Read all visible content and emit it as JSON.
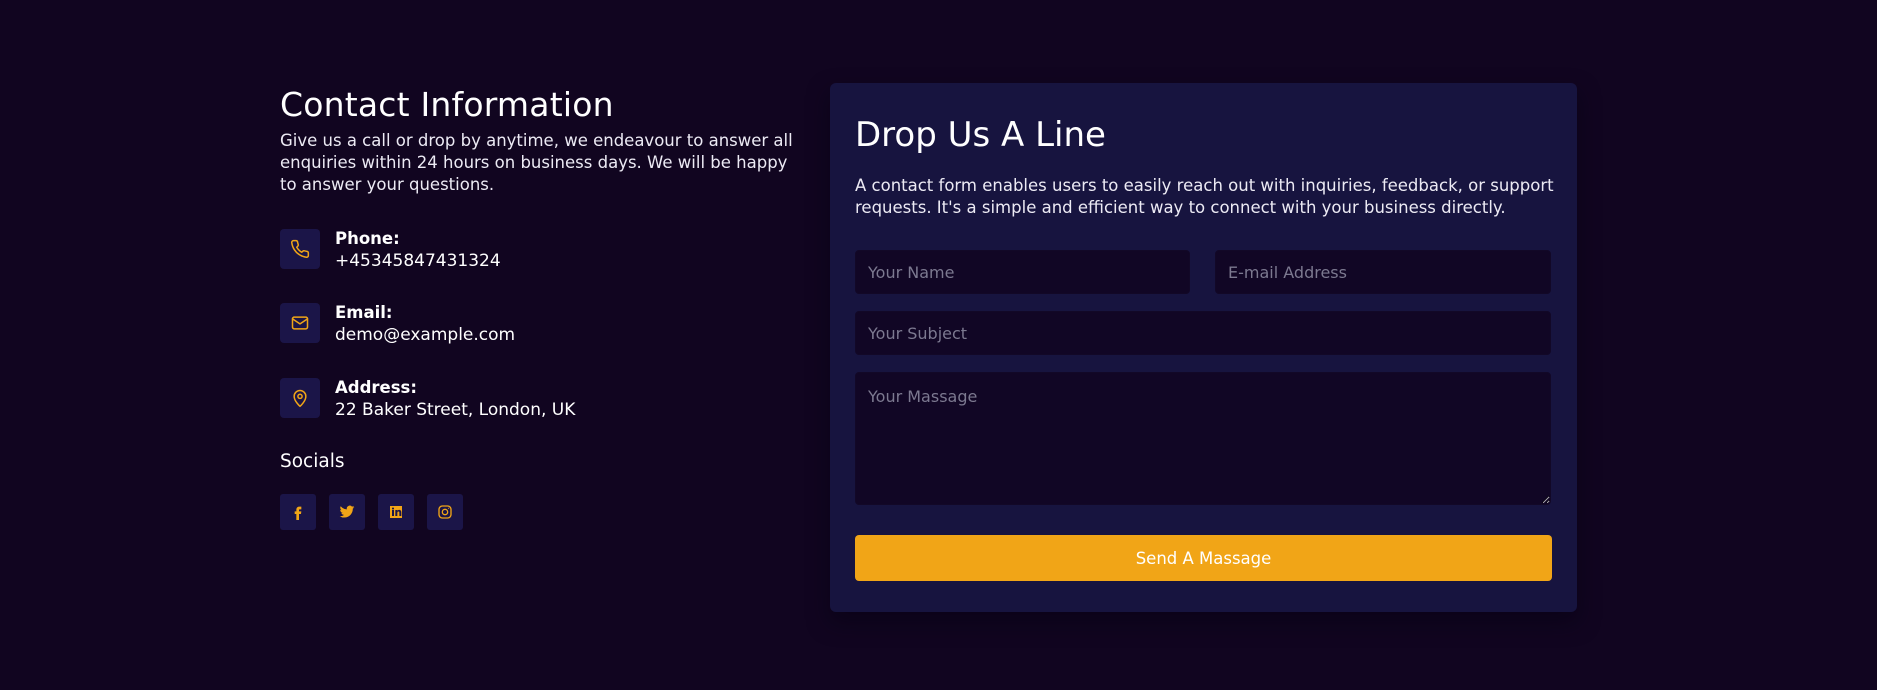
{
  "colors": {
    "background": "#110520",
    "card": "#17143f",
    "icon_tile": "#1b1548",
    "field_bg": "#110625",
    "accent": "#f1a517"
  },
  "contact_info": {
    "title": "Contact Information",
    "intro": "Give us a call or drop by anytime, we endeavour to answer all enquiries within 24 hours on business days. We will be happy to answer your questions.",
    "items": [
      {
        "icon": "phone-icon",
        "label": "Phone:",
        "value": "+45345847431324"
      },
      {
        "icon": "mail-icon",
        "label": "Email:",
        "value": "demo@example.com"
      },
      {
        "icon": "map-pin-icon",
        "label": "Address:",
        "value": "22 Baker Street, London, UK"
      }
    ],
    "socials_title": "Socials",
    "socials": [
      {
        "icon": "facebook-icon"
      },
      {
        "icon": "twitter-icon"
      },
      {
        "icon": "linkedin-icon"
      },
      {
        "icon": "instagram-icon"
      }
    ]
  },
  "form": {
    "title": "Drop Us A Line",
    "description": "A contact form enables users to easily reach out with inquiries, feedback, or support requests. It's a simple and efficient way to connect with your business directly.",
    "name_placeholder": "Your Name",
    "email_placeholder": "E-mail Address",
    "subject_placeholder": "Your Subject",
    "message_placeholder": "Your Massage",
    "name_value": "",
    "email_value": "",
    "subject_value": "",
    "message_value": "",
    "submit_label": "Send A Massage"
  }
}
